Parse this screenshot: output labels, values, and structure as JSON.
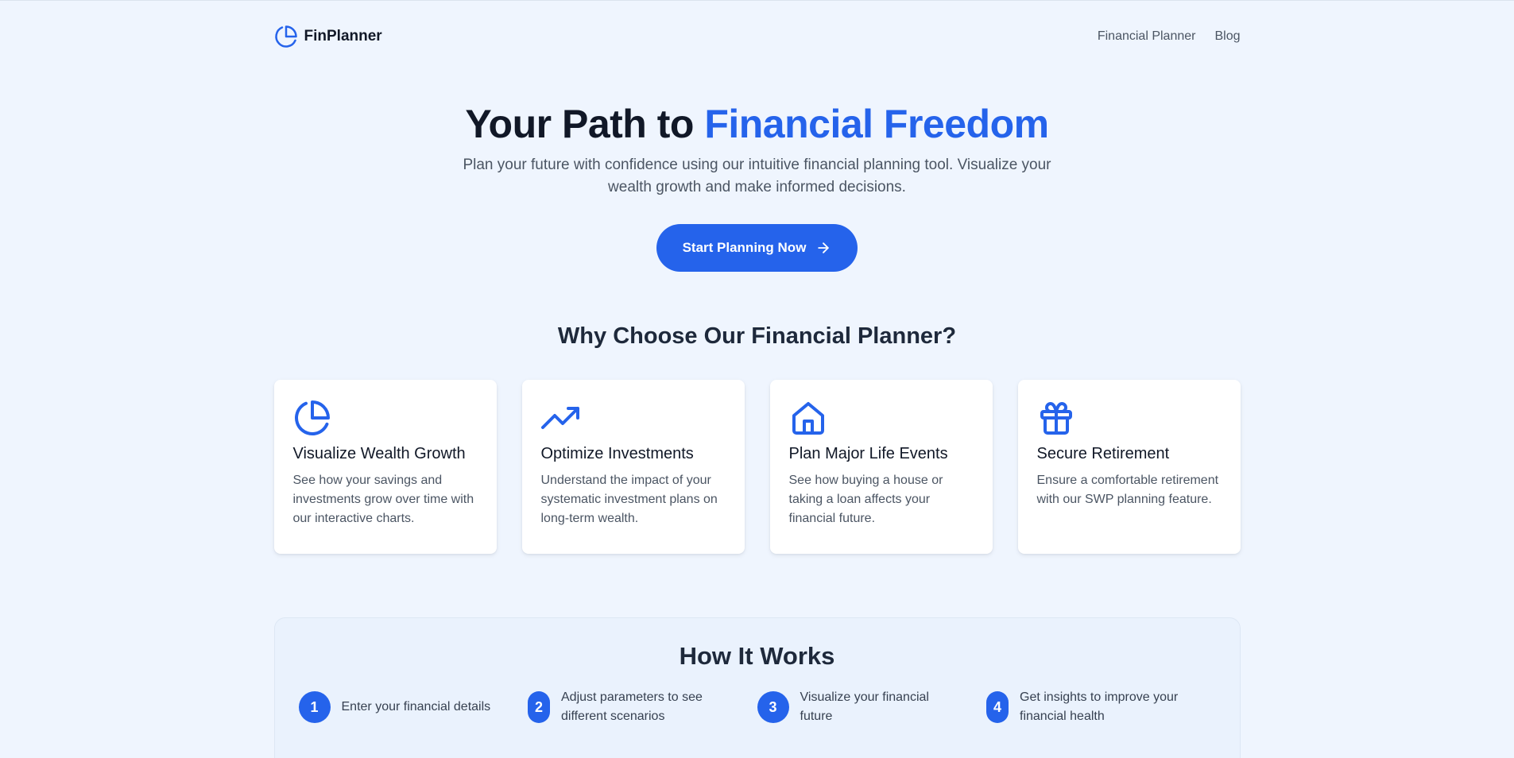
{
  "header": {
    "brand": "FinPlanner",
    "logo_icon": "pie-chart-icon",
    "nav": [
      {
        "label": "Financial Planner"
      },
      {
        "label": "Blog"
      }
    ]
  },
  "hero": {
    "title_start": "Your Path to ",
    "title_accent": "Financial Freedom",
    "subtitle": "Plan your future with confidence using our intuitive financial planning tool. Visualize your wealth growth and make informed decisions.",
    "cta_label": "Start Planning Now",
    "cta_icon": "arrow-right-icon"
  },
  "features": {
    "title": "Why Choose Our Financial Planner?",
    "cards": [
      {
        "icon": "pie-chart-icon",
        "title": "Visualize Wealth Growth",
        "text": "See how your savings and investments grow over time with our interactive charts."
      },
      {
        "icon": "trending-up-icon",
        "title": "Optimize Investments",
        "text": "Understand the impact of your systematic investment plans on long-term wealth."
      },
      {
        "icon": "home-icon",
        "title": "Plan Major Life Events",
        "text": "See how buying a house or taking a loan affects your financial future."
      },
      {
        "icon": "gift-icon",
        "title": "Secure Retirement",
        "text": "Ensure a comfortable retirement with our SWP planning feature."
      }
    ]
  },
  "how_it_works": {
    "title": "How It Works",
    "steps": [
      {
        "number": "1",
        "text": "Enter your financial details"
      },
      {
        "number": "2",
        "text": "Adjust parameters to see different scenarios"
      },
      {
        "number": "3",
        "text": "Visualize your financial future"
      },
      {
        "number": "4",
        "text": "Get insights to improve your financial health"
      }
    ]
  },
  "colors": {
    "accent": "#2563eb",
    "background": "#eff5fe",
    "heading": "#111827",
    "body_text": "#4b5563"
  }
}
